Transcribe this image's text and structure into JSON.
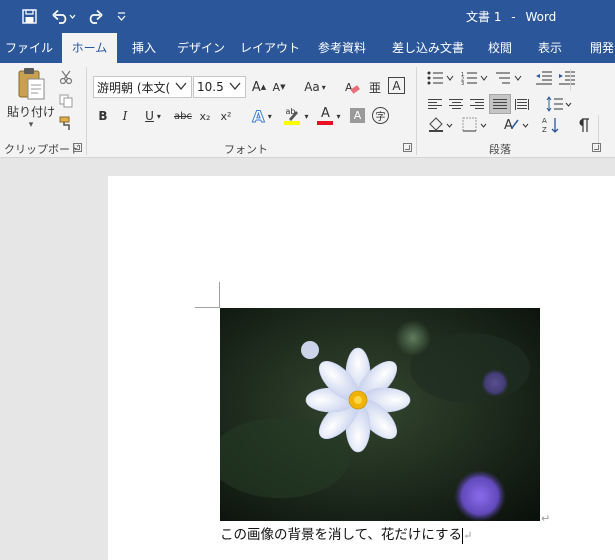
{
  "titlebar": {
    "document_title": "文書 1",
    "separator": "-",
    "app_name": "Word",
    "icons": [
      "save-icon",
      "undo-icon",
      "redo-icon",
      "customize-quick-access-icon"
    ]
  },
  "tabs": [
    {
      "label": "ファイル"
    },
    {
      "label": "ホーム"
    },
    {
      "label": "挿入"
    },
    {
      "label": "デザイン"
    },
    {
      "label": "レイアウト"
    },
    {
      "label": "参考資料"
    },
    {
      "label": "差し込み文書"
    },
    {
      "label": "校閲"
    },
    {
      "label": "表示"
    },
    {
      "label": "開発"
    }
  ],
  "active_tab": "ホーム",
  "ribbon": {
    "clipboard": {
      "group_label": "クリップボード",
      "paste_label": "貼り付け",
      "paste_dropdown": "▾"
    },
    "font": {
      "group_label": "フォント",
      "font_name": "游明朝 (本文(",
      "font_size": "10.5",
      "grow_font": "A",
      "shrink_font": "A",
      "change_case": "Aa",
      "phonetic_ruby": "亜",
      "char_border": "A",
      "bold": "B",
      "italic": "I",
      "underline": "U",
      "strikethrough": "abc",
      "subscript": "x₂",
      "superscript": "x²",
      "text_effects": "A",
      "highlight_letters": "ab",
      "font_color": "A",
      "char_shading": "A",
      "enclose_char": "字"
    },
    "paragraph": {
      "group_label": "段落"
    }
  },
  "document": {
    "body_text": "この画像の背景を消して、花だけにする"
  },
  "colors": {
    "brand": "#2b579a",
    "highlight": "#ffff00",
    "font_color": "#e81123",
    "flower_center": "#f0b400",
    "flower_petals": "#eef2ff"
  }
}
